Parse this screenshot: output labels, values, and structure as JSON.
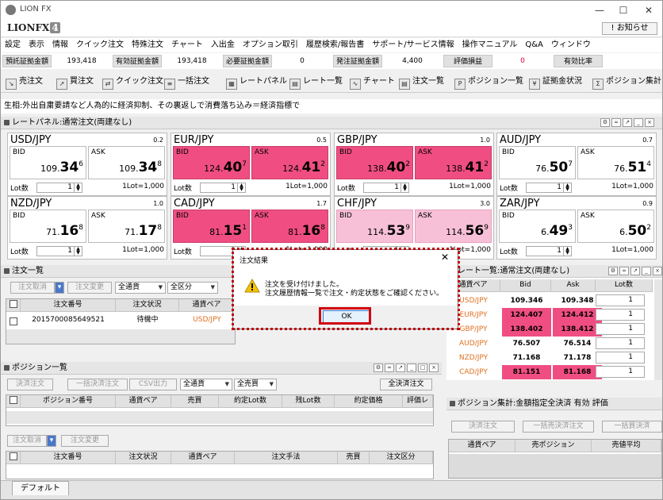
{
  "window": {
    "title": "LION FX",
    "minimize": "—",
    "maximize": "☐",
    "close": "✕"
  },
  "logo": {
    "text": "LIONFX",
    "version": "4"
  },
  "notice_button": "! お知らせ",
  "menu": [
    "設定",
    "表示",
    "情報",
    "クイック注文",
    "特殊注文",
    "チャート",
    "入出金",
    "オプション取引",
    "履歴検索/報告書",
    "サポート/サービス情報",
    "操作マニュアル",
    "Q&A",
    "ウィンドウ"
  ],
  "account": {
    "labels": [
      "預託証拠金額",
      "有効証拠金額",
      "必要証拠金額",
      "発注証拠金額",
      "評価損益",
      "有効比率"
    ],
    "values": [
      "193,418",
      "193,418",
      "0",
      "4,400",
      "0",
      ""
    ]
  },
  "toolbar": [
    "売注文",
    "買注文",
    "クイック注文",
    "一括注文",
    "レートパネル",
    "レート一覧",
    "チャート",
    "注文一覧",
    "ポジション一覧",
    "証拠金状況",
    "ポジション集計"
  ],
  "ticker": "生相:外出自粛要請など人為的に経済抑制、その裏返しで消費落ち込み＝経済指標で",
  "rate_panel": {
    "title": "レートパネル:通常注文(両建なし)",
    "cards": [
      {
        "pair": "USD/JPY",
        "spread": "0.2",
        "bid_s": "109.",
        "bid_b": "34",
        "bid_x": "6",
        "ask_s": "109.",
        "ask_b": "34",
        "ask_x": "8",
        "lot_label": "Lot数",
        "lot": "1",
        "lot_unit": "1Lot=1,000",
        "bid_state": "",
        "ask_state": ""
      },
      {
        "pair": "EUR/JPY",
        "spread": "0.5",
        "bid_s": "124.",
        "bid_b": "40",
        "bid_x": "7",
        "ask_s": "124.",
        "ask_b": "41",
        "ask_x": "2",
        "lot_label": "Lot数",
        "lot": "1",
        "lot_unit": "1Lot=1,000",
        "bid_state": "hot",
        "ask_state": "hot"
      },
      {
        "pair": "GBP/JPY",
        "spread": "1.0",
        "bid_s": "138.",
        "bid_b": "40",
        "bid_x": "2",
        "ask_s": "138.",
        "ask_b": "41",
        "ask_x": "2",
        "lot_label": "Lot数",
        "lot": "1",
        "lot_unit": "1Lot=1,000",
        "bid_state": "hot",
        "ask_state": "hot"
      },
      {
        "pair": "AUD/JPY",
        "spread": "0.7",
        "bid_s": "76.",
        "bid_b": "50",
        "bid_x": "7",
        "ask_s": "76.",
        "ask_b": "51",
        "ask_x": "4",
        "lot_label": "Lot数",
        "lot": "1",
        "lot_unit": "1Lot=1,000",
        "bid_state": "",
        "ask_state": ""
      },
      {
        "pair": "NZD/JPY",
        "spread": "1.0",
        "bid_s": "71.",
        "bid_b": "16",
        "bid_x": "8",
        "ask_s": "71.",
        "ask_b": "17",
        "ask_x": "8",
        "lot_label": "Lot数",
        "lot": "1",
        "lot_unit": "1Lot=1,000",
        "bid_state": "",
        "ask_state": ""
      },
      {
        "pair": "CAD/JPY",
        "spread": "1.7",
        "bid_s": "81.",
        "bid_b": "15",
        "bid_x": "1",
        "ask_s": "81.",
        "ask_b": "16",
        "ask_x": "8",
        "lot_label": "Lot数",
        "lot": "1",
        "lot_unit": "1Lot=1,000",
        "bid_state": "hot",
        "ask_state": "hot"
      },
      {
        "pair": "CHF/JPY",
        "spread": "3.0",
        "bid_s": "114.",
        "bid_b": "53",
        "bid_x": "9",
        "ask_s": "114.",
        "ask_b": "56",
        "ask_x": "9",
        "lot_label": "Lot数",
        "lot": "1",
        "lot_unit": "1Lot=1,000",
        "bid_state": "warm",
        "ask_state": "warm"
      },
      {
        "pair": "ZAR/JPY",
        "spread": "0.9",
        "bid_s": "6.",
        "bid_b": "49",
        "bid_x": "3",
        "ask_s": "6.",
        "ask_b": "50",
        "ask_x": "2",
        "lot_label": "Lot数",
        "lot": "1",
        "lot_unit": "1Lot=1,000",
        "bid_state": "",
        "ask_state": ""
      }
    ],
    "bid_label": "BID",
    "ask_label": "ASK"
  },
  "order_list": {
    "title": "注文一覧",
    "cancel_btn": "注文取消",
    "modify_btn": "注文変更",
    "currency_sel": "全通貨",
    "type_sel": "全区分",
    "headers": [
      "注文番号",
      "注文状況",
      "通貨ペア"
    ],
    "rows": [
      {
        "no": "201570008564952​1",
        "status": "待機中",
        "pair": "USD/JPY"
      }
    ]
  },
  "position_list": {
    "title": "ポジション一覧",
    "settle_btn": "決済注文",
    "bulk_btn": "一括決済注文",
    "csv_btn": "CSV出力",
    "currency_sel": "全通貨",
    "side_sel": "全売買",
    "all_settle_btn": "全決済注文",
    "headers": [
      "ポジション番号",
      "通貨ペア",
      "売買",
      "約定Lot数",
      "残Lot数",
      "約定価格",
      "評価レ"
    ],
    "order_cancel_btn": "注文取消",
    "order_modify_btn": "注文変更",
    "order_headers": [
      "注文番号",
      "注文状況",
      "通貨ペア",
      "注文手法",
      "売買",
      "注文区分"
    ]
  },
  "rate_list": {
    "title": "レート一覧:通常注文(両建なし)",
    "headers": [
      "通貨ペア",
      "Bid",
      "Ask",
      "Lot数"
    ],
    "rows": [
      {
        "pair": "USD/JPY",
        "bid": "109.346",
        "ask": "109.348",
        "lot": "1",
        "hot": false
      },
      {
        "pair": "EUR/JPY",
        "bid": "124.407",
        "ask": "124.412",
        "lot": "1",
        "hot": true
      },
      {
        "pair": "GBP/JPY",
        "bid": "138.402",
        "ask": "138.412",
        "lot": "1",
        "hot": true
      },
      {
        "pair": "AUD/JPY",
        "bid": "76.507",
        "ask": "76.514",
        "lot": "1",
        "hot": false
      },
      {
        "pair": "NZD/JPY",
        "bid": "71.168",
        "ask": "71.178",
        "lot": "1",
        "hot": false
      },
      {
        "pair": "CAD/JPY",
        "bid": "81.151",
        "ask": "81.168",
        "lot": "1",
        "hot": true
      }
    ]
  },
  "position_summary": {
    "title": "ポジション集計:金額指定全決済 有効 評価",
    "settle_btn": "決済注文",
    "bulk_sell_btn": "一括売決済注文",
    "bulk_buy_btn": "一括買決済",
    "headers": [
      "通貨ペア",
      "売ポジション",
      "売値平均"
    ]
  },
  "dialog": {
    "title": "注文結果",
    "line1": "注文を受け付けました。",
    "line2": "注文履歴情報一覧で注文・約定状態をご確認ください。",
    "ok": "OK",
    "close": "✕"
  },
  "bottom_tab": "デフォルト",
  "colors": {
    "hot": "#f04e82",
    "warm": "#f7c0d6",
    "highlight": "#d0000e",
    "pair_orange": "#e07020"
  }
}
